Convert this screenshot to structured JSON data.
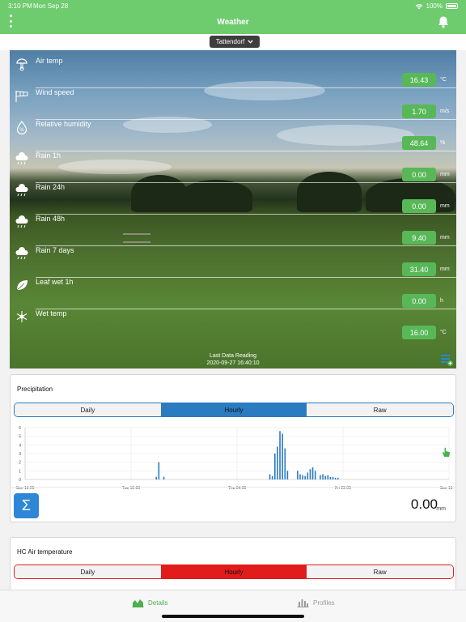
{
  "status_bar": {
    "time": "3:10 PM",
    "date": "Mon Sep 28",
    "battery": "100%"
  },
  "nav": {
    "title": "Weather"
  },
  "location": {
    "selected": "Tattendorf"
  },
  "sensors": [
    {
      "label": "Air temp",
      "value": "16.43",
      "unit": "°C",
      "icon": "thermometer-icon"
    },
    {
      "label": "Wind speed",
      "value": "1.70",
      "unit": "m/s",
      "icon": "windsock-icon"
    },
    {
      "label": "Relative humidity",
      "value": "48.64",
      "unit": "%",
      "icon": "humidity-icon"
    },
    {
      "label": "Rain 1h",
      "value": "0.00",
      "unit": "mm",
      "icon": "rain-1h-icon"
    },
    {
      "label": "Rain 24h",
      "value": "0.00",
      "unit": "mm",
      "icon": "rain-24h-icon"
    },
    {
      "label": "Rain 48h",
      "value": "9.40",
      "unit": "mm",
      "icon": "rain-48h-icon"
    },
    {
      "label": "Rain 7 days",
      "value": "31.40",
      "unit": "mm",
      "icon": "rain-7d-icon"
    },
    {
      "label": "Leaf wet 1h",
      "value": "0.00",
      "unit": "h",
      "icon": "leaf-wetness-icon"
    },
    {
      "label": "Wet temp",
      "value": "16.00",
      "unit": "°C",
      "icon": "wet-temp-icon"
    }
  ],
  "last_reading": {
    "label": "Last Data Reading",
    "value": "2020-09-27 16:40:10"
  },
  "precipitation": {
    "title": "Precipitation",
    "tabs": [
      "Daily",
      "Hourly",
      "Raw"
    ],
    "active_tab": "Hourly",
    "total": "0.00",
    "total_unit": "mm"
  },
  "air_temperature": {
    "title": "HC Air temperature",
    "tabs": [
      "Daily",
      "Hourly",
      "Raw"
    ],
    "active_tab": "Hourly"
  },
  "chart_data": {
    "type": "bar",
    "title": "",
    "xlabel": "",
    "ylabel": "",
    "ylim": [
      0,
      6
    ],
    "yticks": [
      "0",
      "1",
      "2",
      "3",
      "4",
      "5",
      "6"
    ],
    "xticks": [
      "Sun 16:00",
      "Tue 10:00",
      "Thu 04:00",
      "Fri 22:00",
      "Sun 16:00"
    ],
    "x_unit": "hours since Sun 16:00",
    "x_range": [
      0,
      168
    ],
    "bars": [
      {
        "x": 52,
        "y": 0.3
      },
      {
        "x": 53,
        "y": 2.0
      },
      {
        "x": 55,
        "y": 0.3
      },
      {
        "x": 97,
        "y": 0.6
      },
      {
        "x": 98,
        "y": 0.4
      },
      {
        "x": 99,
        "y": 3.0
      },
      {
        "x": 100,
        "y": 3.8
      },
      {
        "x": 101,
        "y": 5.6
      },
      {
        "x": 102,
        "y": 5.3
      },
      {
        "x": 103,
        "y": 3.6
      },
      {
        "x": 104,
        "y": 1.0
      },
      {
        "x": 108,
        "y": 1.0
      },
      {
        "x": 109,
        "y": 0.6
      },
      {
        "x": 110,
        "y": 0.5
      },
      {
        "x": 111,
        "y": 0.4
      },
      {
        "x": 112,
        "y": 0.8
      },
      {
        "x": 113,
        "y": 1.2
      },
      {
        "x": 114,
        "y": 1.4
      },
      {
        "x": 115,
        "y": 1.0
      },
      {
        "x": 117,
        "y": 0.5
      },
      {
        "x": 118,
        "y": 0.6
      },
      {
        "x": 119,
        "y": 0.4
      },
      {
        "x": 120,
        "y": 0.5
      },
      {
        "x": 121,
        "y": 0.3
      },
      {
        "x": 122,
        "y": 0.3
      },
      {
        "x": 123,
        "y": 0.2
      },
      {
        "x": 124,
        "y": 0.2
      }
    ],
    "color": "#2a7bc0",
    "grid": true
  },
  "tabbar": {
    "details": "Details",
    "profiles": "Profiles"
  }
}
